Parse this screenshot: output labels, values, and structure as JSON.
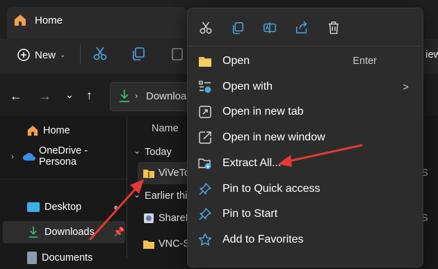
{
  "window": {
    "tab_title": "Home",
    "toolbar": {
      "new_label": "New",
      "right_partial": "iew"
    },
    "address": {
      "path_text": "Downloads"
    }
  },
  "nav": {
    "items": [
      {
        "label": "Home"
      },
      {
        "label": "OneDrive - Persona"
      },
      {
        "label": "Desktop"
      },
      {
        "label": "Downloads"
      },
      {
        "label": "Documents"
      }
    ]
  },
  "files": {
    "column_name": "Name",
    "group_today": "Today",
    "item_selected": "ViVeTo",
    "group_earlier": "Earlier this",
    "item_share": "ShareM",
    "item_vnc": "VNC-S",
    "edge_chars": [
      "S",
      "S"
    ]
  },
  "context_menu": {
    "quick_actions": [
      "cut-icon",
      "copy-icon",
      "rename-icon",
      "share-icon",
      "delete-icon"
    ],
    "items": [
      {
        "label": "Open",
        "shortcut": "Enter"
      },
      {
        "label": "Open with",
        "submenu": ">"
      },
      {
        "label": "Open in new tab"
      },
      {
        "label": "Open in new window"
      },
      {
        "label": "Extract All..."
      },
      {
        "label": "Pin to Quick access"
      },
      {
        "label": "Pin to Start"
      },
      {
        "label": "Add to Favorites"
      }
    ]
  },
  "colors": {
    "accent": "#4fa8e0",
    "annotation_arrow": "#e53935",
    "folder": "#f2c14e"
  }
}
